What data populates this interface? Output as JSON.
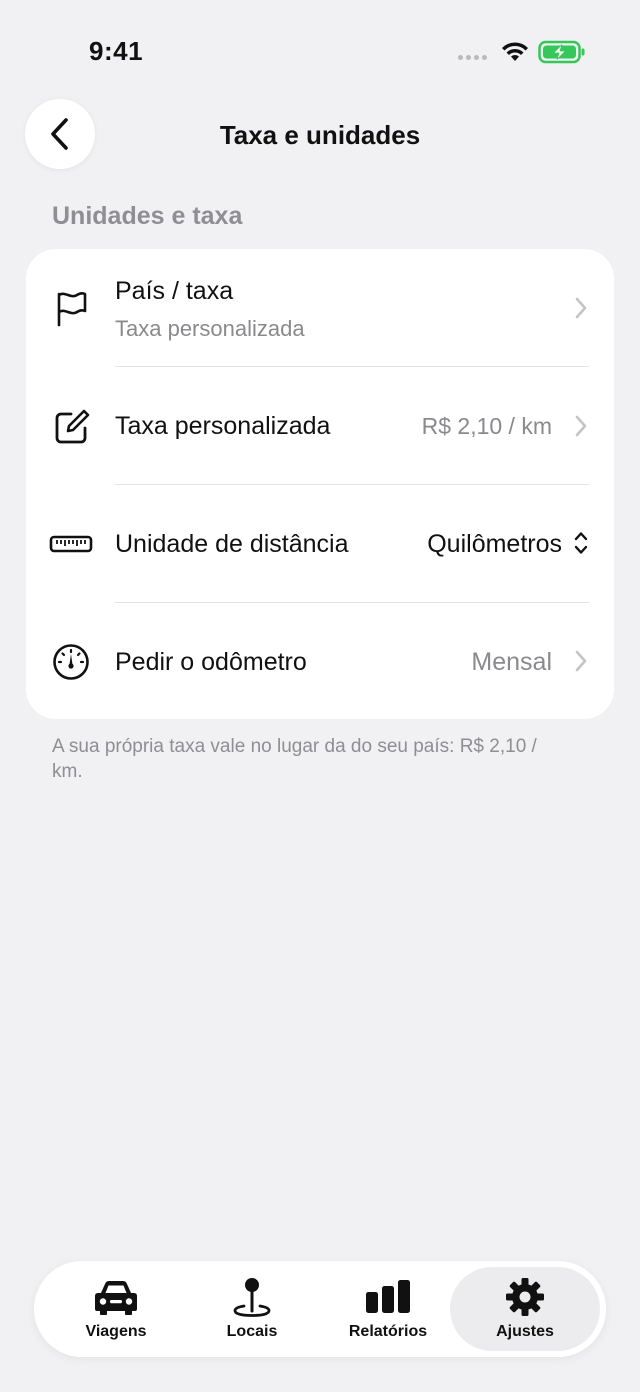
{
  "status_bar": {
    "time": "9:41"
  },
  "nav": {
    "title": "Taxa e unidades"
  },
  "section": {
    "header": "Unidades e taxa"
  },
  "rows": [
    {
      "label": "País / taxa",
      "sublabel": "Taxa personalizada",
      "value": "",
      "icon": "flag-icon"
    },
    {
      "label": "Taxa personalizada",
      "value": "R$ 2,10 / km",
      "icon": "edit-square-icon"
    },
    {
      "label": "Unidade de distância",
      "value": "Quilômetros",
      "icon": "ruler-icon"
    },
    {
      "label": "Pedir o odômetro",
      "value": "Mensal",
      "icon": "gauge-icon"
    }
  ],
  "footnote": "A sua própria taxa vale no lugar da do seu país: R$ 2,10 / km.",
  "tabs": [
    {
      "label": "Viagens",
      "icon": "car-icon"
    },
    {
      "label": "Locais",
      "icon": "map-pin-icon"
    },
    {
      "label": "Relatórios",
      "icon": "bar-chart-icon"
    },
    {
      "label": "Ajustes",
      "icon": "gear-icon"
    }
  ],
  "colors": {
    "background": "#f1f1f3",
    "battery": "#34c759"
  }
}
